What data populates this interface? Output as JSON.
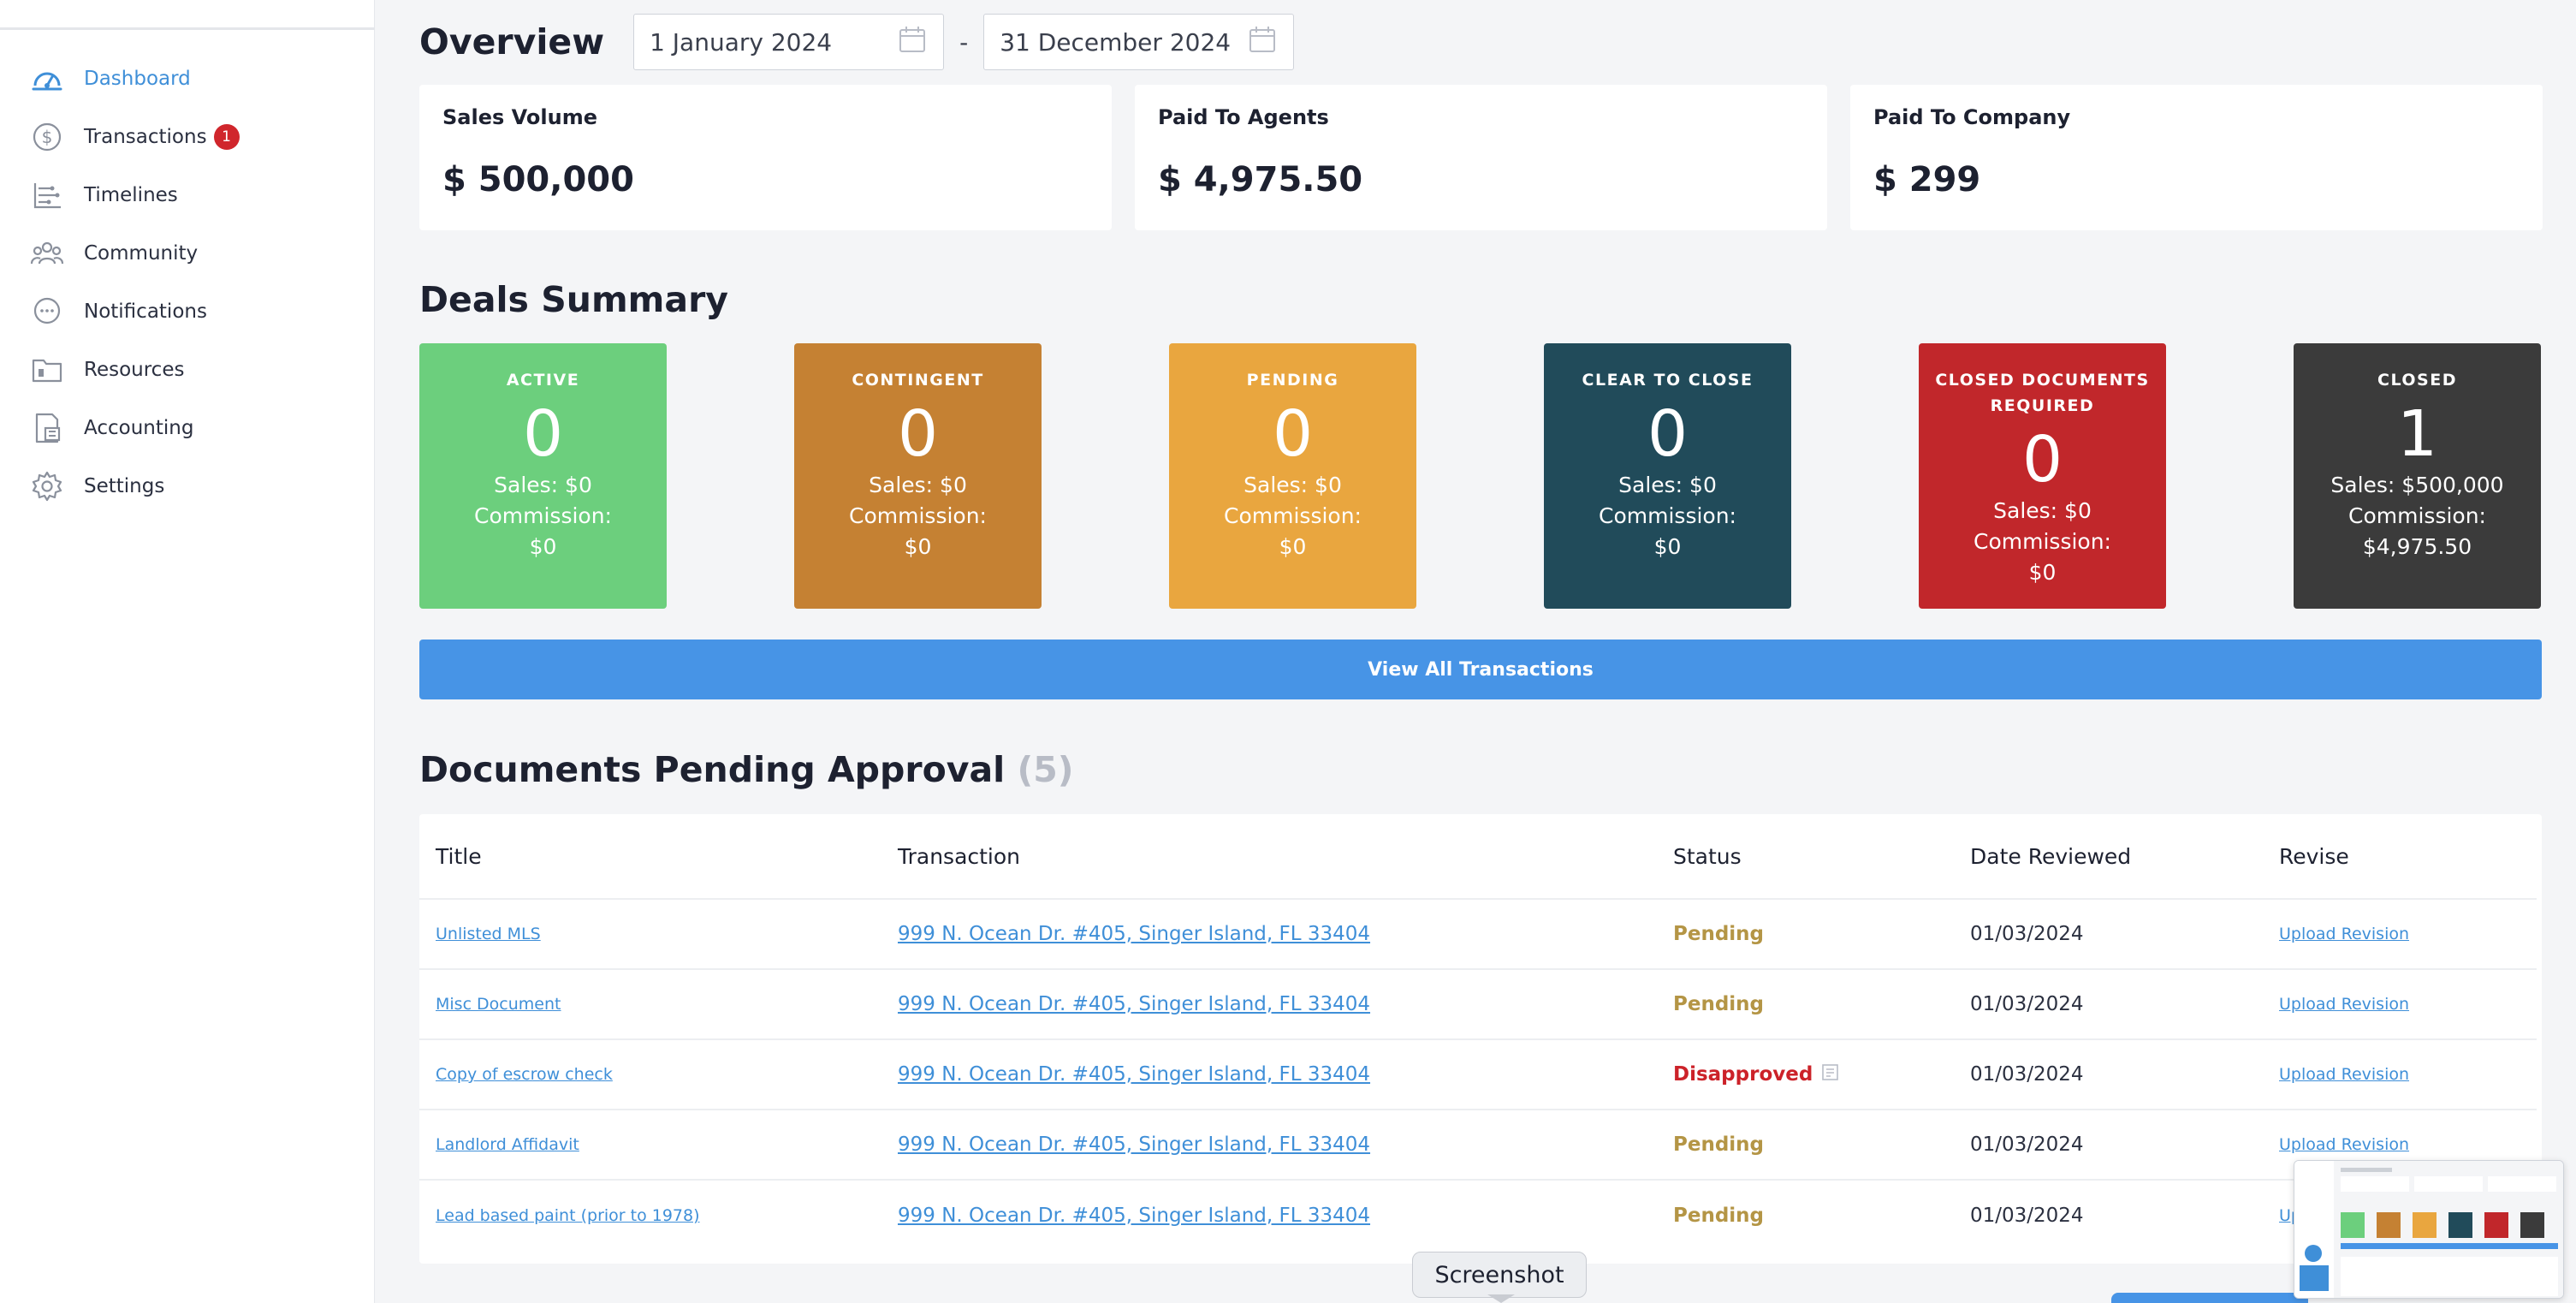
{
  "sidebar": {
    "items": [
      {
        "label": "Dashboard",
        "icon": "dashboard-gauge-icon",
        "active": true
      },
      {
        "label": "Transactions",
        "icon": "dollar-coin-icon",
        "badge": "1"
      },
      {
        "label": "Timelines",
        "icon": "timeline-icon"
      },
      {
        "label": "Community",
        "icon": "people-group-icon"
      },
      {
        "label": "Notifications",
        "icon": "chat-bubble-icon"
      },
      {
        "label": "Resources",
        "icon": "folder-icon"
      },
      {
        "label": "Accounting",
        "icon": "ledger-icon"
      },
      {
        "label": "Settings",
        "icon": "gear-icon"
      }
    ]
  },
  "overview": {
    "title": "Overview",
    "start_date": "1 January 2024",
    "end_date": "31 December 2024",
    "separator": "-"
  },
  "stats": [
    {
      "label": "Sales Volume",
      "value": "$ 500,000"
    },
    {
      "label": "Paid To Agents",
      "value": "$ 4,975.50"
    },
    {
      "label": "Paid To Company",
      "value": "$ 299"
    }
  ],
  "deals": {
    "title": "Deals Summary",
    "cards": [
      {
        "name": "ACTIVE",
        "count": "0",
        "sales": "Sales: $0",
        "commission_label": "Commission:",
        "commission": "$0",
        "color": "#6ccf7d"
      },
      {
        "name": "CONTINGENT",
        "count": "0",
        "sales": "Sales: $0",
        "commission_label": "Commission:",
        "commission": "$0",
        "color": "#c58133"
      },
      {
        "name": "PENDING",
        "count": "0",
        "sales": "Sales: $0",
        "commission_label": "Commission:",
        "commission": "$0",
        "color": "#e9a63f"
      },
      {
        "name": "CLEAR TO CLOSE",
        "count": "0",
        "sales": "Sales: $0",
        "commission_label": "Commission:",
        "commission": "$0",
        "color": "#214b5a"
      },
      {
        "name": "CLOSED DOCUMENTS REQUIRED",
        "count": "0",
        "sales": "Sales: $0",
        "commission_label": "Commission:",
        "commission": "$0",
        "color": "#c1272b"
      },
      {
        "name": "CLOSED",
        "count": "1",
        "sales": "Sales: $500,000",
        "commission_label": "Commission:",
        "commission": "$4,975.50",
        "color": "#3b3b3b"
      }
    ],
    "view_all_label": "View All Transactions"
  },
  "documents": {
    "title": "Documents Pending Approval",
    "count": "(5)",
    "columns": {
      "title": "Title",
      "transaction": "Transaction",
      "status": "Status",
      "date": "Date Reviewed",
      "revise": "Revise"
    },
    "rows": [
      {
        "title": "Unlisted MLS",
        "transaction": "999 N. Ocean Dr. #405, Singer Island, FL 33404",
        "status": "Pending",
        "date": "01/03/2024",
        "revise": "Upload Revision"
      },
      {
        "title": "Misc Document",
        "transaction": "999 N. Ocean Dr. #405, Singer Island, FL 33404",
        "status": "Pending",
        "date": "01/03/2024",
        "revise": "Upload Revision"
      },
      {
        "title": "Copy of escrow check",
        "transaction": "999 N. Ocean Dr. #405, Singer Island, FL 33404",
        "status": "Disapproved",
        "date": "01/03/2024",
        "revise": "Upload Revision"
      },
      {
        "title": "Landlord Affidavit",
        "transaction": "999 N. Ocean Dr. #405, Singer Island, FL 33404",
        "status": "Pending",
        "date": "01/03/2024",
        "revise": "Upload Revision"
      },
      {
        "title": "Lead based paint (prior to 1978)",
        "transaction": "999 N. Ocean Dr. #405, Singer Island, FL 33404",
        "status": "Pending",
        "date": "01/03/2024",
        "revise": "Upl"
      }
    ]
  },
  "tooltip": {
    "label": "Screenshot"
  },
  "colors": {
    "accent": "#4794e6",
    "link": "#3f8fd8",
    "pending": "#b49545",
    "disapproved": "#cc2229",
    "badge": "#d0262c"
  }
}
